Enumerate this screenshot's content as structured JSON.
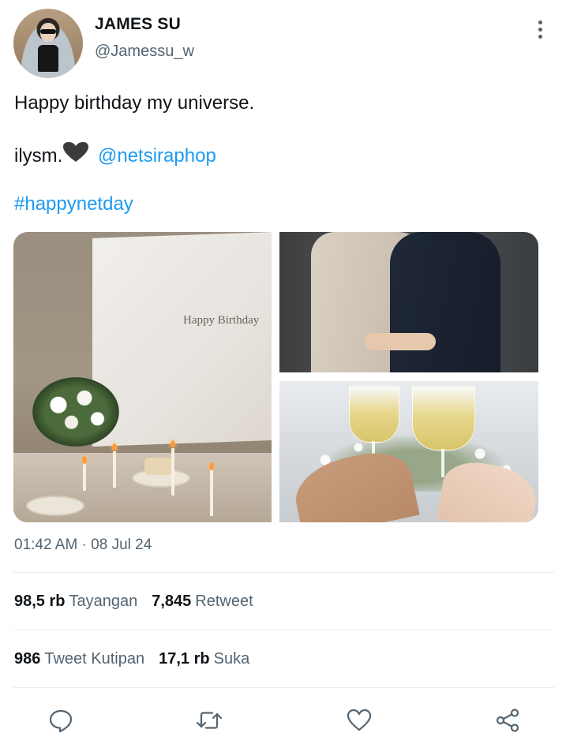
{
  "author": {
    "name": "JAMES SU",
    "handle": "@Jamessu_w"
  },
  "tweet": {
    "line1": "Happy birthday my universe.",
    "line2_text": "ilysm.",
    "line2_emoji": "black-heart-icon",
    "mention": "@netsiraphop",
    "hashtag": "#happynetday"
  },
  "media": {
    "left_photo_text": "Happy Birthday"
  },
  "timestamp": "01:42 AM · 08 Jul 24",
  "stats": {
    "views_count": "98,5 rb",
    "views_label": "Tayangan",
    "retweets_count": "7,845",
    "retweets_label": "Retweet",
    "quotes_count": "986",
    "quotes_label": "Tweet Kutipan",
    "likes_count": "17,1 rb",
    "likes_label": "Suka"
  },
  "actions": [
    "reply-icon",
    "retweet-icon",
    "like-icon",
    "share-icon"
  ],
  "colors": {
    "link": "#1d9bf0",
    "secondary_text": "#536471",
    "primary_text": "#0f1419",
    "divider": "#e6ecf0"
  }
}
